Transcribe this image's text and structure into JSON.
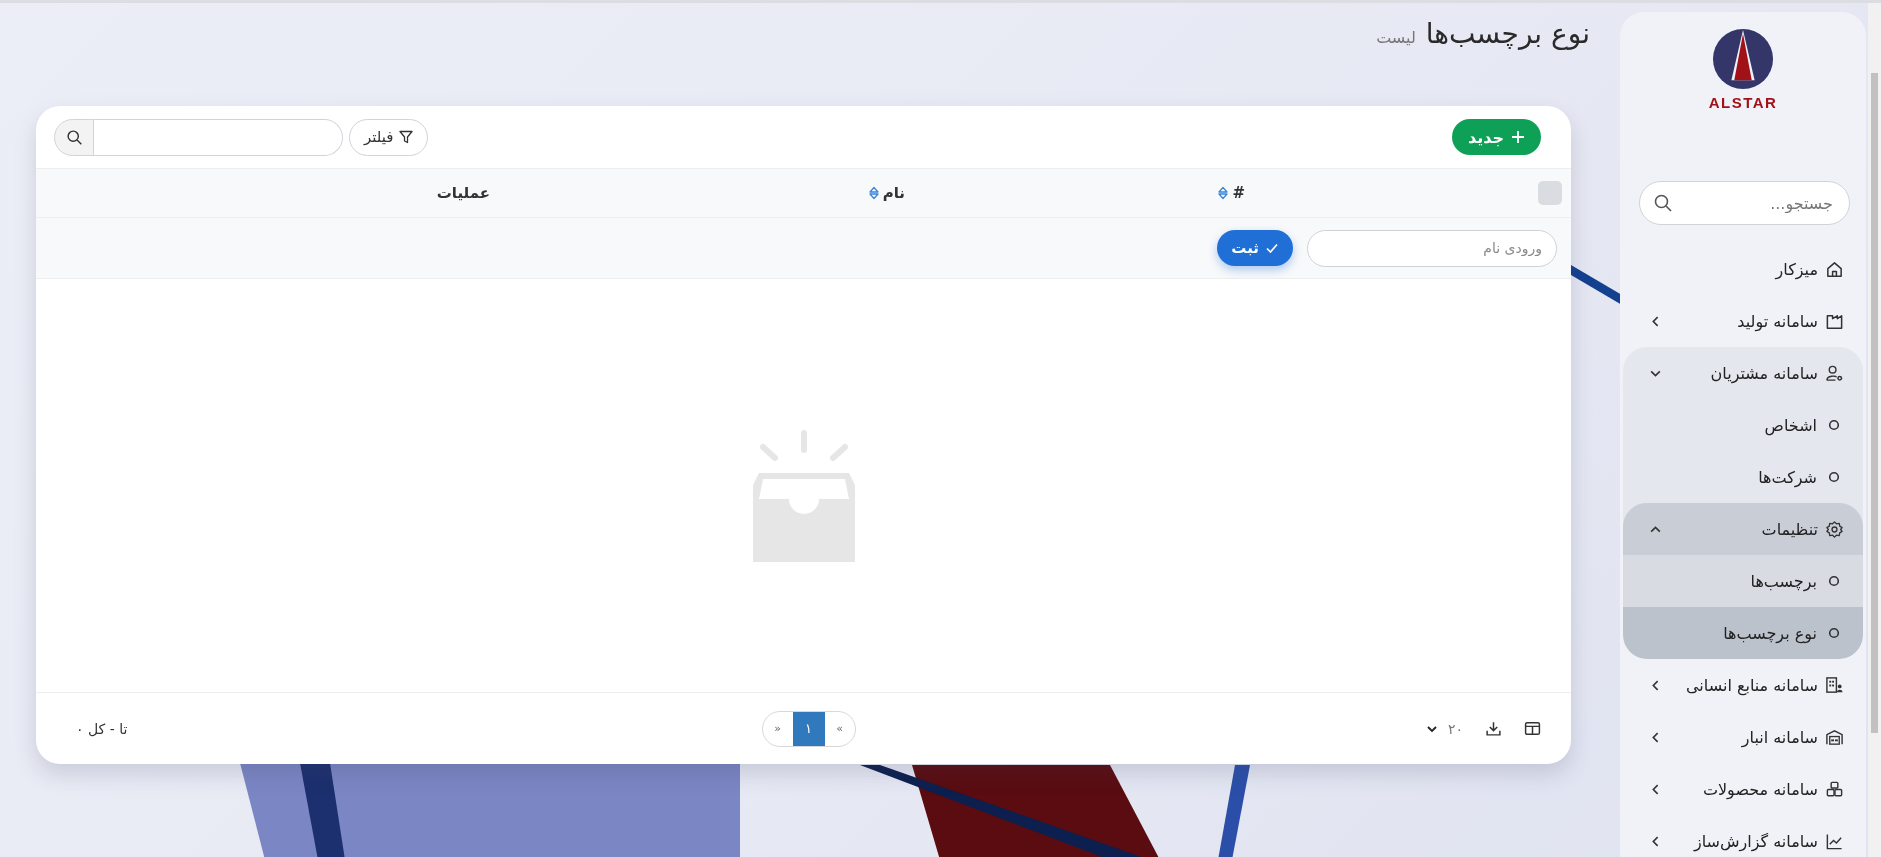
{
  "page_header": {
    "title": "نوع برچسب‌ها",
    "subtitle": "لیست"
  },
  "toolbar": {
    "new_button": "جدید",
    "filter_button": "فیلتر"
  },
  "table": {
    "select_all": {
      "checked": false
    },
    "columns": [
      {
        "label": "#",
        "sortable": true
      },
      {
        "label": "نام",
        "sortable": true
      },
      {
        "label": "عملیات",
        "sortable": false
      }
    ],
    "filter_row": {
      "name_input": {
        "placeholder": "ورودی نام"
      },
      "submit_button": "ثبت"
    }
  },
  "footer": {
    "page_size": "۲۰",
    "pagination": {
      "right_arrow": "»",
      "pages": [
        {
          "label": "۱",
          "selected": true
        }
      ],
      "left_arrow": "«"
    },
    "summary": "تا - کل ۰"
  },
  "sidebar": {
    "logo": {
      "text": "ALSTAR"
    },
    "search": {
      "placeholder": "جستجو..."
    },
    "items": [
      {
        "label": "میزکار",
        "selected": false
      },
      {
        "label": "سامانه تولید",
        "selected": false,
        "expanded": false
      },
      {
        "label": "سامانه مشتریان",
        "selected": false,
        "expanded": true,
        "children": [
          {
            "label": "اشخاص",
            "selected": false
          },
          {
            "label": "شرکت‌ها",
            "selected": false
          },
          {
            "label": "تنظیمات",
            "selected": false,
            "expanded": true,
            "children": [
              {
                "label": "برچسب‌ها",
                "selected": false
              },
              {
                "label": "نوع برچسب‌ها",
                "selected": true
              }
            ]
          }
        ]
      },
      {
        "label": "سامانه منابع انسانی",
        "selected": false,
        "expanded": false
      },
      {
        "label": "سامانه انبار",
        "selected": false,
        "expanded": false
      },
      {
        "label": "سامانه محصولات",
        "selected": false,
        "expanded": false
      },
      {
        "label": "سامانه گزارش‌ساز",
        "selected": false,
        "expanded": false
      }
    ]
  }
}
